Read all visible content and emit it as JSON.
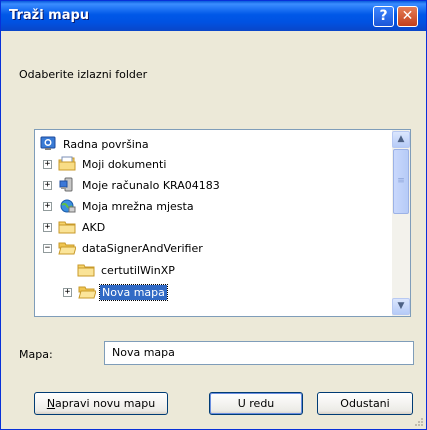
{
  "window": {
    "title": "Traži mapu",
    "help_label": "?",
    "close_label": "✕"
  },
  "prompt": "Odaberite izlazni folder",
  "tree": {
    "items": [
      {
        "label": "Radna površina",
        "icon": "desktop-icon",
        "expander": "",
        "selected": false
      },
      {
        "label": "Moji dokumenti",
        "icon": "documents-folder-icon",
        "expander": "+",
        "selected": false
      },
      {
        "label": "Moje računalo KRA04183",
        "icon": "computer-icon",
        "expander": "+",
        "selected": false
      },
      {
        "label": "Moja mrežna mjesta",
        "icon": "network-icon",
        "expander": "+",
        "selected": false
      },
      {
        "label": "AKD",
        "icon": "folder-icon",
        "expander": "+",
        "selected": false
      },
      {
        "label": "dataSignerAndVerifier",
        "icon": "folder-open-icon",
        "expander": "−",
        "selected": false
      },
      {
        "label": "certutilWinXP",
        "icon": "folder-icon",
        "expander": "",
        "selected": false
      },
      {
        "label": "Nova mapa",
        "icon": "folder-open-icon",
        "expander": "+",
        "selected": true
      }
    ],
    "scroll_up": "▲",
    "scroll_down": "▼",
    "thumb_grip": "≡"
  },
  "folder_field": {
    "label": "Mapa:",
    "value": "Nova mapa"
  },
  "buttons": {
    "new_folder_label": "Napravi novu mapu",
    "ok_label": "U redu",
    "cancel_label": "Odustani"
  },
  "colors": {
    "titlebar": "#0058e8",
    "selection": "#316ac5",
    "dialog_bg": "#ece9d8"
  }
}
